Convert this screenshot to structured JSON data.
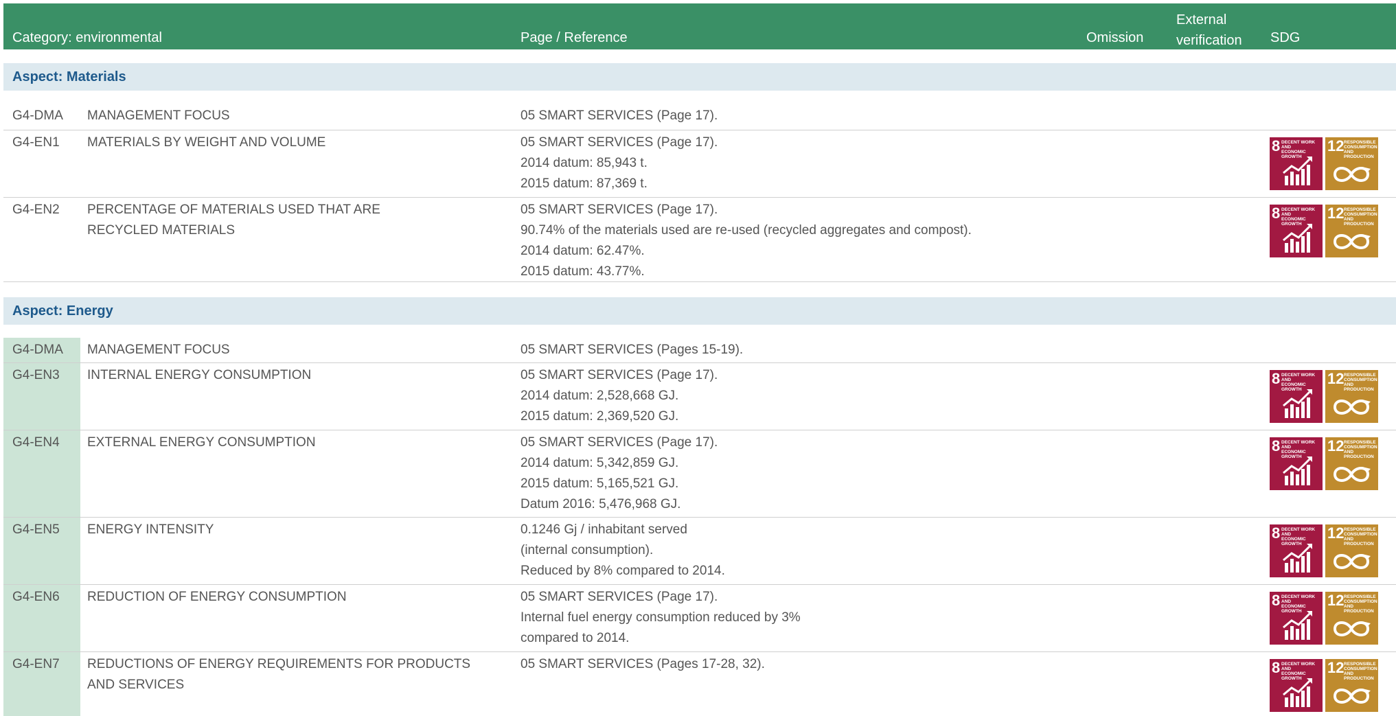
{
  "header": {
    "category": "Category: environmental",
    "page_reference": "Page / Reference",
    "omission": "Omission",
    "external_verification_line1": "External",
    "external_verification_line2": "verification",
    "sdg": "SDG"
  },
  "sdg_icons": {
    "goal8": {
      "number": "8",
      "title_line1": "DECENT WORK AND",
      "title_line2": "ECONOMIC GROWTH",
      "color": "#a21942",
      "icon": "rising-bar-chart-icon"
    },
    "goal12": {
      "number": "12",
      "title_line1": "RESPONSIBLE",
      "title_line2": "CONSUMPTION",
      "title_line3": "AND PRODUCTION",
      "color": "#bf8b2e",
      "icon": "infinity-loop-icon"
    }
  },
  "sections": [
    {
      "aspect": "Aspect: Materials",
      "rows": [
        {
          "code": "G4-DMA",
          "name": [
            "MANAGEMENT FOCUS"
          ],
          "ref": [
            "05 SMART SERVICES (Page 17)."
          ]
        },
        {
          "code": "G4-EN1",
          "name": [
            "MATERIALS BY WEIGHT AND VOLUME"
          ],
          "ref": [
            "05 SMART SERVICES (Page 17).",
            "2014 datum: 85,943 t.",
            "2015 datum: 87,369 t."
          ]
        },
        {
          "code": "G4-EN2",
          "name": [
            "PERCENTAGE OF MATERIALS USED THAT ARE",
            "RECYCLED MATERIALS"
          ],
          "ref": [
            "05 SMART SERVICES (Page 17).",
            "90.74% of the materials used are re-used (recycled aggregates and compost).",
            "2014 datum: 62.47%.",
            "2015 datum: 43.77%."
          ]
        }
      ]
    },
    {
      "aspect": "Aspect: Energy",
      "rows": [
        {
          "code": "G4-DMA",
          "name": [
            "MANAGEMENT FOCUS"
          ],
          "ref": [
            "05 SMART SERVICES (Pages 15-19)."
          ]
        },
        {
          "code": "G4-EN3",
          "name": [
            "INTERNAL ENERGY CONSUMPTION"
          ],
          "ref": [
            "05 SMART SERVICES (Page 17).",
            "2014 datum: 2,528,668 GJ.",
            "2015 datum: 2,369,520 GJ."
          ]
        },
        {
          "code": "G4-EN4",
          "name": [
            "EXTERNAL ENERGY CONSUMPTION"
          ],
          "ref": [
            "05 SMART SERVICES (Page 17).",
            "2014 datum: 5,342,859 GJ.",
            "2015 datum: 5,165,521 GJ.",
            "Datum 2016: 5,476,968 GJ."
          ]
        },
        {
          "code": "G4-EN5",
          "name": [
            "ENERGY INTENSITY"
          ],
          "ref": [
            "0.1246 Gj / inhabitant served",
            "(internal consumption).",
            "Reduced by 8% compared to 2014."
          ]
        },
        {
          "code": "G4-EN6",
          "name": [
            "REDUCTION OF ENERGY CONSUMPTION"
          ],
          "ref": [
            "05 SMART SERVICES (Page 17).",
            "Internal fuel energy consumption reduced by 3%",
            "compared to 2014."
          ]
        },
        {
          "code": "G4-EN7",
          "name": [
            "REDUCTIONS OF ENERGY REQUIREMENTS FOR PRODUCTS",
            "AND SERVICES"
          ],
          "ref": [
            "05 SMART SERVICES (Pages 17-28, 32)."
          ]
        }
      ]
    }
  ]
}
